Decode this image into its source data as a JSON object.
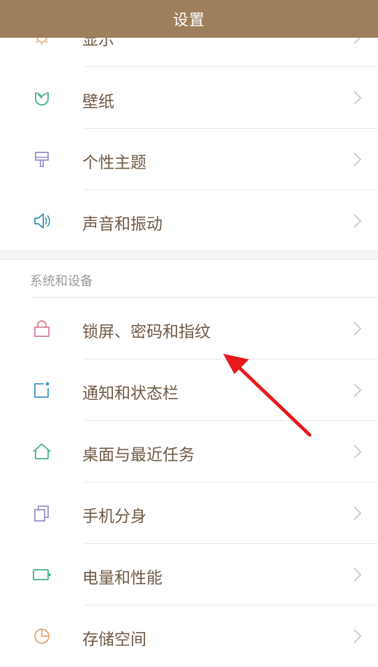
{
  "header": {
    "title": "设置"
  },
  "rows_top": [
    {
      "label": "显示",
      "icon": "sun-icon",
      "color": "#e6a372"
    },
    {
      "label": "壁纸",
      "icon": "tulip-icon",
      "color": "#3fae94"
    },
    {
      "label": "个性主题",
      "icon": "brush-icon",
      "color": "#9b8ccf"
    },
    {
      "label": "声音和振动",
      "icon": "speaker-icon",
      "color": "#3c8fb5"
    }
  ],
  "section": {
    "title": "系统和设备"
  },
  "rows_system": [
    {
      "label": "锁屏、密码和指纹",
      "icon": "lock-icon",
      "color": "#d9808f"
    },
    {
      "label": "通知和状态栏",
      "icon": "notification-icon",
      "color": "#3c97c9"
    },
    {
      "label": "桌面与最近任务",
      "icon": "home-icon",
      "color": "#3fae94"
    },
    {
      "label": "手机分身",
      "icon": "dual-app-icon",
      "color": "#9b8ccf"
    },
    {
      "label": "电量和性能",
      "icon": "battery-icon",
      "color": "#3fae94"
    },
    {
      "label": "存储空间",
      "icon": "storage-icon",
      "color": "#e6a372"
    }
  ],
  "annotation": {
    "color": "#e8191b",
    "icon": "red-arrow-annotation"
  }
}
